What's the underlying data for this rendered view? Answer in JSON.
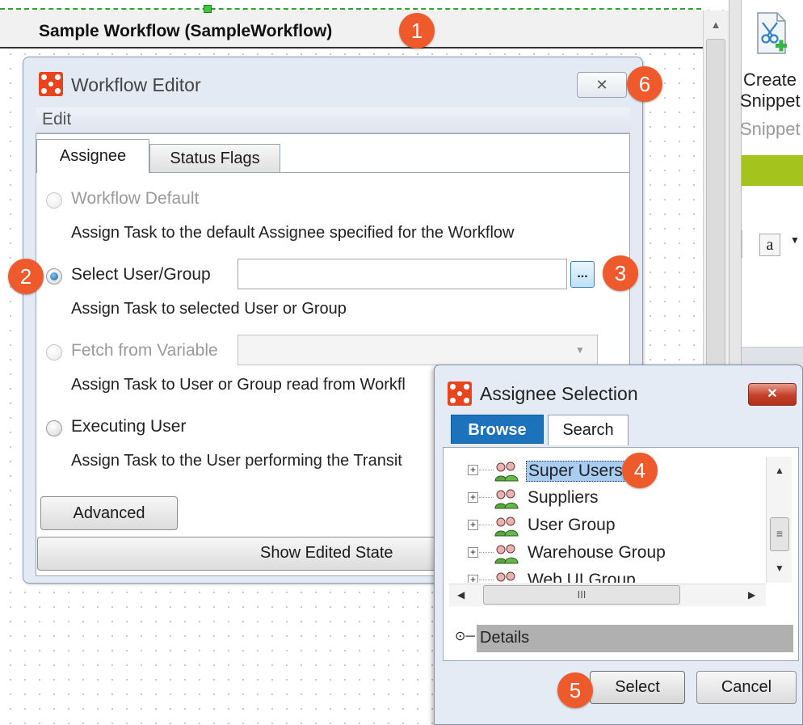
{
  "canvas": {
    "title": "Sample Workflow (SampleWorkflow)"
  },
  "ribbon": {
    "button_label_line1": "Create",
    "button_label_line2": "Snippet",
    "group_label": "Snippet",
    "accent_color": "#a4c31c",
    "font_icon": "a",
    "dropdown_glyph": "▼"
  },
  "workflow_editor": {
    "title": "Workflow Editor",
    "close_glyph": "✕",
    "menu": {
      "edit": "Edit"
    },
    "tabs": [
      {
        "label": "Assignee",
        "active": true
      },
      {
        "label": "Status Flags",
        "active": false
      }
    ],
    "options": [
      {
        "label": "Workflow Default",
        "description": "Assign Task to the default Assignee specified for the Workflow",
        "enabled": false,
        "checked": false
      },
      {
        "label": "Select User/Group",
        "description": "Assign Task to selected User or Group",
        "enabled": true,
        "checked": true
      },
      {
        "label": "Fetch from Variable",
        "description": "Assign Task to User or Group read from Workfl",
        "enabled": false,
        "checked": false
      },
      {
        "label": "Executing User",
        "description": "Assign Task to the User performing the Transit",
        "enabled": true,
        "checked": false
      }
    ],
    "user_group_value": "",
    "browse_button": "...",
    "advanced_button": "Advanced",
    "show_edited_state_button": "Show Edited State"
  },
  "assignee_selection": {
    "title": "Assignee Selection",
    "close_glyph": "✕",
    "tabs": [
      {
        "label": "Browse",
        "active": true
      },
      {
        "label": "Search",
        "active": false
      }
    ],
    "tree_items": [
      {
        "label": "Super Users",
        "selected": true
      },
      {
        "label": "Suppliers",
        "selected": false
      },
      {
        "label": "User Group",
        "selected": false
      },
      {
        "label": "Warehouse Group",
        "selected": false
      },
      {
        "label": "Web UI Group",
        "selected": false
      }
    ],
    "expander_glyph": "+",
    "details_label": "Details",
    "select_button": "Select",
    "cancel_button": "Cancel",
    "selection_color": "#a9cdf2",
    "tab_color": "#1c73bb"
  },
  "badges": [
    "1",
    "2",
    "3",
    "4",
    "5",
    "6"
  ],
  "badge_color": "#ee5a2c"
}
